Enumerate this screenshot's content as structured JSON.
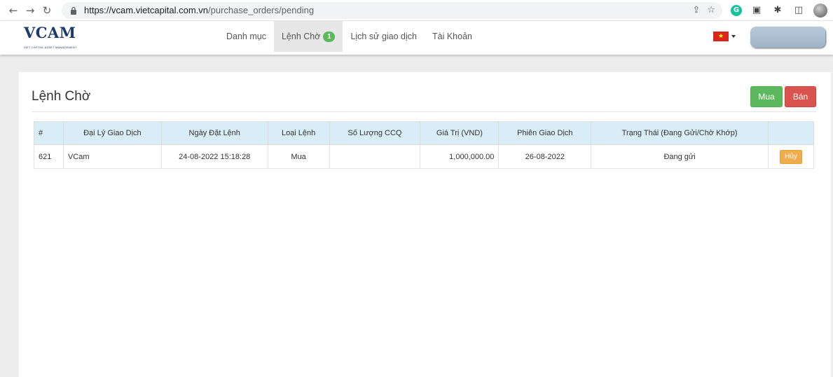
{
  "browser": {
    "url_host": "https://vcam.vietcapital.com.vn",
    "url_path": "/purchase_orders/pending"
  },
  "logo": {
    "text": "VCAM",
    "subtext": "VIET CAPITAL ASSET MANAGEMENT"
  },
  "nav": {
    "items": [
      {
        "label": "Danh mục"
      },
      {
        "label": "Lệnh Chờ",
        "badge": "1"
      },
      {
        "label": "Lịch sử giao dịch"
      },
      {
        "label": "Tài Khoản"
      }
    ]
  },
  "page": {
    "title": "Lệnh Chờ",
    "buy_label": "Mua",
    "sell_label": "Bán"
  },
  "table": {
    "headers": [
      "#",
      "Đại Lý Giao Dịch",
      "Ngày Đặt Lệnh",
      "Loại Lệnh",
      "Số Lượng CCQ",
      "Giá Trị (VND)",
      "Phiên Giao Dịch",
      "Trạng Thái (Đang Gửi/Chờ Khớp)",
      ""
    ],
    "rows": [
      {
        "id": "621",
        "agent": "VCam",
        "date": "24-08-2022 15:18:28",
        "type": "Mua",
        "quantity": "",
        "value": "1,000,000.00",
        "session": "26-08-2022",
        "status": "Đang gửi",
        "action": "Hủy"
      }
    ]
  },
  "colors": {
    "success": "#5cb85c",
    "danger": "#d9534f",
    "warning": "#f0ad4e",
    "table_header": "#d9edf7",
    "brand": "#1b3a6b"
  }
}
